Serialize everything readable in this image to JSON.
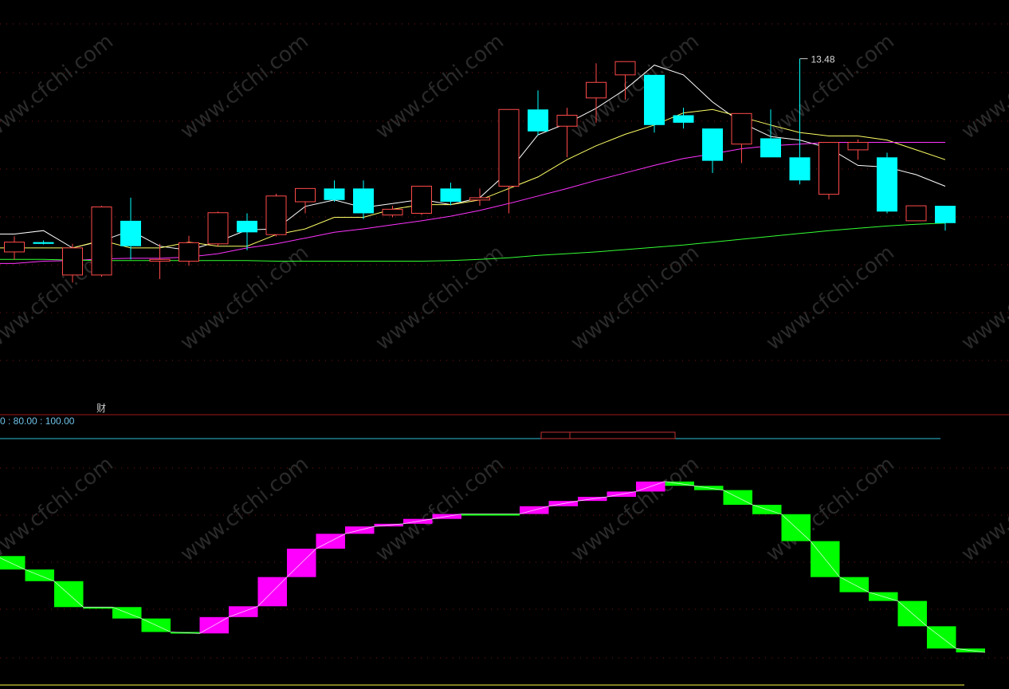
{
  "chart_data": [
    {
      "type": "candlestick",
      "title": "",
      "ylim": [
        8.0,
        14.0
      ],
      "annotations": {
        "peak_label": "13.48",
        "marker_label": "财"
      },
      "colors": {
        "up": "#ff4a4a",
        "down": "#00ffff",
        "ma5": "#ffffff",
        "ma10": "#ffff66",
        "ma20": "#ff33ff",
        "ma60": "#33ff33"
      },
      "candles": [
        {
          "o": 10.13,
          "h": 10.4,
          "l": 10.0,
          "c": 10.3
        },
        {
          "o": 10.3,
          "h": 10.33,
          "l": 10.26,
          "c": 10.27
        },
        {
          "o": 9.73,
          "h": 10.27,
          "l": 9.6,
          "c": 10.2
        },
        {
          "o": 9.73,
          "h": 10.93,
          "l": 9.7,
          "c": 10.91
        },
        {
          "o": 10.67,
          "h": 11.07,
          "l": 10.0,
          "c": 10.23
        },
        {
          "o": 9.97,
          "h": 10.27,
          "l": 9.66,
          "c": 10.0
        },
        {
          "o": 9.97,
          "h": 10.41,
          "l": 9.89,
          "c": 10.29
        },
        {
          "o": 10.27,
          "h": 10.83,
          "l": 10.23,
          "c": 10.81
        },
        {
          "o": 10.67,
          "h": 10.8,
          "l": 10.16,
          "c": 10.47
        },
        {
          "o": 10.43,
          "h": 11.14,
          "l": 10.4,
          "c": 11.1
        },
        {
          "o": 11.0,
          "h": 11.23,
          "l": 10.8,
          "c": 11.23
        },
        {
          "o": 11.23,
          "h": 11.37,
          "l": 11.0,
          "c": 11.03
        },
        {
          "o": 11.23,
          "h": 11.37,
          "l": 10.7,
          "c": 10.8
        },
        {
          "o": 10.77,
          "h": 10.93,
          "l": 10.73,
          "c": 10.87
        },
        {
          "o": 10.8,
          "h": 11.27,
          "l": 10.77,
          "c": 11.27
        },
        {
          "o": 11.23,
          "h": 11.33,
          "l": 10.94,
          "c": 11.0
        },
        {
          "o": 11.03,
          "h": 11.23,
          "l": 10.93,
          "c": 11.07
        },
        {
          "o": 11.27,
          "h": 12.6,
          "l": 10.8,
          "c": 12.6
        },
        {
          "o": 12.6,
          "h": 12.93,
          "l": 12.15,
          "c": 12.22
        },
        {
          "o": 12.31,
          "h": 12.63,
          "l": 11.77,
          "c": 12.5
        },
        {
          "o": 12.8,
          "h": 13.4,
          "l": 12.37,
          "c": 13.07
        },
        {
          "o": 13.2,
          "h": 13.43,
          "l": 12.77,
          "c": 13.43
        },
        {
          "o": 13.2,
          "h": 13.2,
          "l": 12.2,
          "c": 12.33
        },
        {
          "o": 12.5,
          "h": 12.63,
          "l": 12.27,
          "c": 12.37
        },
        {
          "o": 12.27,
          "h": 12.27,
          "l": 11.5,
          "c": 11.71
        },
        {
          "o": 12.0,
          "h": 12.53,
          "l": 11.67,
          "c": 12.53
        },
        {
          "o": 12.1,
          "h": 12.6,
          "l": 11.77,
          "c": 11.77
        },
        {
          "o": 11.77,
          "h": 13.48,
          "l": 11.3,
          "c": 11.37
        },
        {
          "o": 11.13,
          "h": 12.03,
          "l": 11.04,
          "c": 12.03
        },
        {
          "o": 11.9,
          "h": 12.08,
          "l": 11.73,
          "c": 12.03
        },
        {
          "o": 11.77,
          "h": 11.85,
          "l": 10.8,
          "c": 10.83
        },
        {
          "o": 10.67,
          "h": 10.93,
          "l": 10.67,
          "c": 10.93
        },
        {
          "o": 10.93,
          "h": 10.93,
          "l": 10.5,
          "c": 10.63
        }
      ],
      "ma_lines": [
        {
          "name": "",
          "color": "#ffffff",
          "values": [
            10.44,
            10.5,
            10.2,
            10.32,
            10.5,
            10.23,
            10.16,
            10.31,
            10.51,
            10.53,
            10.92,
            11.03,
            10.9,
            10.97,
            11.04,
            10.95,
            11.07,
            11.53,
            12.16,
            12.36,
            12.62,
            12.95,
            13.37,
            13.2,
            12.73,
            12.37,
            12.13,
            12.07,
            11.93,
            11.63,
            11.6,
            11.47,
            11.27
          ]
        },
        {
          "name": "",
          "color": "#ffff66",
          "values": [
            10.2,
            10.2,
            10.2,
            10.33,
            10.2,
            10.2,
            10.3,
            10.23,
            10.23,
            10.43,
            10.53,
            10.73,
            10.73,
            10.87,
            10.95,
            10.95,
            11.03,
            11.23,
            11.43,
            11.73,
            11.97,
            12.17,
            12.33,
            12.54,
            12.6,
            12.47,
            12.33,
            12.2,
            12.14,
            12.14,
            12.07,
            11.9,
            11.73
          ]
        },
        {
          "name": "",
          "color": "#ff33ff",
          "values": [
            9.93,
            9.97,
            9.98,
            10.01,
            10.02,
            10.02,
            10.04,
            10.1,
            10.2,
            10.27,
            10.37,
            10.47,
            10.53,
            10.6,
            10.67,
            10.75,
            10.85,
            10.97,
            11.1,
            11.23,
            11.37,
            11.5,
            11.63,
            11.75,
            11.83,
            11.92,
            11.97,
            12.0,
            12.03,
            12.03,
            12.03,
            12.03,
            12.03
          ]
        },
        {
          "name": "",
          "color": "#33ff33",
          "values": [
            10.0,
            10.0,
            9.99,
            9.98,
            9.98,
            9.98,
            9.98,
            9.98,
            9.98,
            9.97,
            9.97,
            9.97,
            9.97,
            9.97,
            9.97,
            9.98,
            10.0,
            10.03,
            10.07,
            10.1,
            10.13,
            10.17,
            10.21,
            10.25,
            10.3,
            10.35,
            10.4,
            10.45,
            10.5,
            10.54,
            10.58,
            10.61,
            10.63
          ]
        }
      ]
    },
    {
      "type": "step-band",
      "title": "",
      "header_label": "0 : 80.00 : 100.00",
      "ylim": [
        0,
        100
      ],
      "colors": {
        "up": "#ff00ff",
        "down": "#00ff00",
        "line": "#ffffff"
      },
      "steps": [
        {
          "a": 62.0,
          "b": 55.4
        },
        {
          "a": 55.4,
          "b": 49.7
        },
        {
          "a": 49.7,
          "b": 37.0
        },
        {
          "a": 37.0,
          "b": 37.0
        },
        {
          "a": 37.0,
          "b": 31.4
        },
        {
          "a": 31.4,
          "b": 24.8
        },
        {
          "a": 24.8,
          "b": 24.1
        },
        {
          "a": 24.1,
          "b": 32.1
        },
        {
          "a": 32.1,
          "b": 37.4
        },
        {
          "a": 37.4,
          "b": 51.7
        },
        {
          "a": 51.7,
          "b": 65.6
        },
        {
          "a": 65.6,
          "b": 72.9
        },
        {
          "a": 72.9,
          "b": 76.5
        },
        {
          "a": 76.5,
          "b": 77.8
        },
        {
          "a": 77.8,
          "b": 80.2
        },
        {
          "a": 80.2,
          "b": 82.6
        },
        {
          "a": 82.6,
          "b": 82.6
        },
        {
          "a": 82.6,
          "b": 82.6
        },
        {
          "a": 82.6,
          "b": 86.4
        },
        {
          "a": 86.4,
          "b": 89.0
        },
        {
          "a": 89.0,
          "b": 91.0
        },
        {
          "a": 91.0,
          "b": 93.6
        },
        {
          "a": 93.6,
          "b": 98.5
        },
        {
          "a": 98.5,
          "b": 96.4
        },
        {
          "a": 96.4,
          "b": 94.3
        },
        {
          "a": 94.3,
          "b": 87.1
        },
        {
          "a": 87.1,
          "b": 82.5
        },
        {
          "a": 82.5,
          "b": 69.3
        },
        {
          "a": 69.3,
          "b": 51.7
        },
        {
          "a": 51.7,
          "b": 44.3
        },
        {
          "a": 44.3,
          "b": 40.0
        },
        {
          "a": 40.0,
          "b": 27.6
        },
        {
          "a": 27.6,
          "b": 16.7
        },
        {
          "a": 16.7,
          "b": 14.8
        }
      ]
    }
  ]
}
